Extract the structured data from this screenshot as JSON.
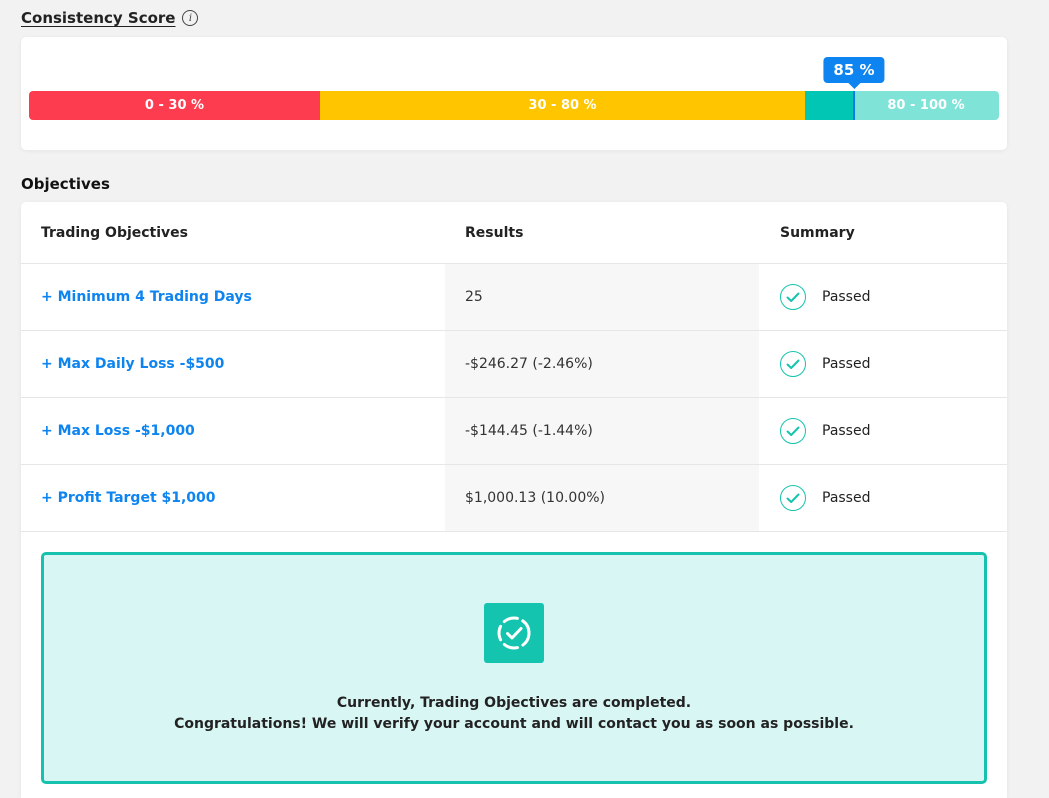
{
  "consistency": {
    "title": "Consistency Score",
    "info_icon": "info-icon",
    "score_value": 85,
    "score_label": "85 %",
    "segments": [
      {
        "label": "0 - 30 %",
        "color": "#fe3c4f"
      },
      {
        "label": "30 - 80 %",
        "color": "#ffc600"
      },
      {
        "label": "80 - 100 %",
        "color": "#80e3d8",
        "fill_color": "#00c6b3"
      }
    ],
    "marker_color": "#0d84ef"
  },
  "objectives": {
    "title": "Objectives",
    "columns": [
      "Trading Objectives",
      "Results",
      "Summary"
    ],
    "rows": [
      {
        "objective": "+ Minimum 4 Trading Days",
        "result": "25",
        "status": "Passed"
      },
      {
        "objective": "+ Max Daily Loss -$500",
        "result": "-$246.27 (-2.46%)",
        "status": "Passed"
      },
      {
        "objective": "+ Max Loss -$1,000",
        "result": "-$144.45 (-1.44%)",
        "status": "Passed"
      },
      {
        "objective": "+ Profit Target $1,000",
        "result": "$1,000.13 (10.00%)",
        "status": "Passed"
      }
    ],
    "status_icon": "check-circle-icon"
  },
  "completion": {
    "icon": "dashed-check-circle-icon",
    "line1": "Currently, Trading Objectives are completed.",
    "line2": "Congratulations! We will verify your account and will contact you as soon as possible.",
    "accent_color": "#16c2ad",
    "background_color": "#d8f6f4"
  }
}
